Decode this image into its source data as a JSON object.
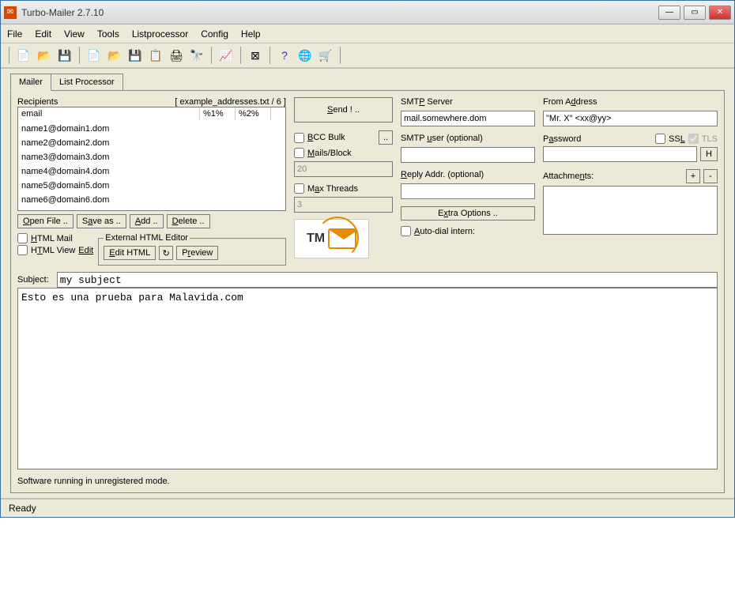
{
  "window": {
    "title": "Turbo-Mailer 2.7.10"
  },
  "menu": [
    "File",
    "Edit",
    "View",
    "Tools",
    "Listprocessor",
    "Config",
    "Help"
  ],
  "tabs": [
    "Mailer",
    "List Processor"
  ],
  "recipients": {
    "label": "Recipients",
    "summary": "[ example_addresses.txt / 6 ]",
    "cols": {
      "c1": "email",
      "c2": "%1%",
      "c3": "%2%"
    },
    "rows": [
      "name1@domain1.dom",
      "name2@domain2.dom",
      "name3@domain3.dom",
      "name4@domain4.dom",
      "name5@domain5.dom",
      "name6@domain6.dom"
    ],
    "btnOpen": "Open File ..",
    "btnSave": "Save as ..",
    "btnAdd": "Add ..",
    "btnDelete": "Delete .."
  },
  "htmlMail": {
    "chk1": "HTML Mail",
    "chk2": "HTML View",
    "editLink": "Edit",
    "editorLegend": "External HTML Editor",
    "editHtml": "Edit HTML",
    "preview": "Preview"
  },
  "send": {
    "btn": "Send ! ..",
    "bcc": "BCC Bulk",
    "mails": "Mails/Block",
    "mailsVal": "20",
    "max": "Max Threads",
    "maxVal": "3"
  },
  "smtp": {
    "serverLbl": "SMTP Server",
    "server": "mail.somewhere.dom",
    "userLbl": "SMTP user (optional)",
    "user": "",
    "replyLbl": "Reply Addr. (optional)",
    "reply": "",
    "extra": "Extra Options ..",
    "autodial": "Auto-dial intern:"
  },
  "right": {
    "fromLbl": "From Address",
    "from": "\"Mr. X\" <xx@yy>",
    "pwdLbl": "Password",
    "ssl": "SSL",
    "tls": "TLS",
    "hBtn": "H",
    "attachLbl": "Attachments:",
    "plus": "+",
    "minus": "-"
  },
  "subject": {
    "lbl": "Subject:",
    "val": "my subject"
  },
  "body": "Esto es una prueba para Malavida.com",
  "footer": "Software running in unregistered mode.",
  "status": "Ready"
}
